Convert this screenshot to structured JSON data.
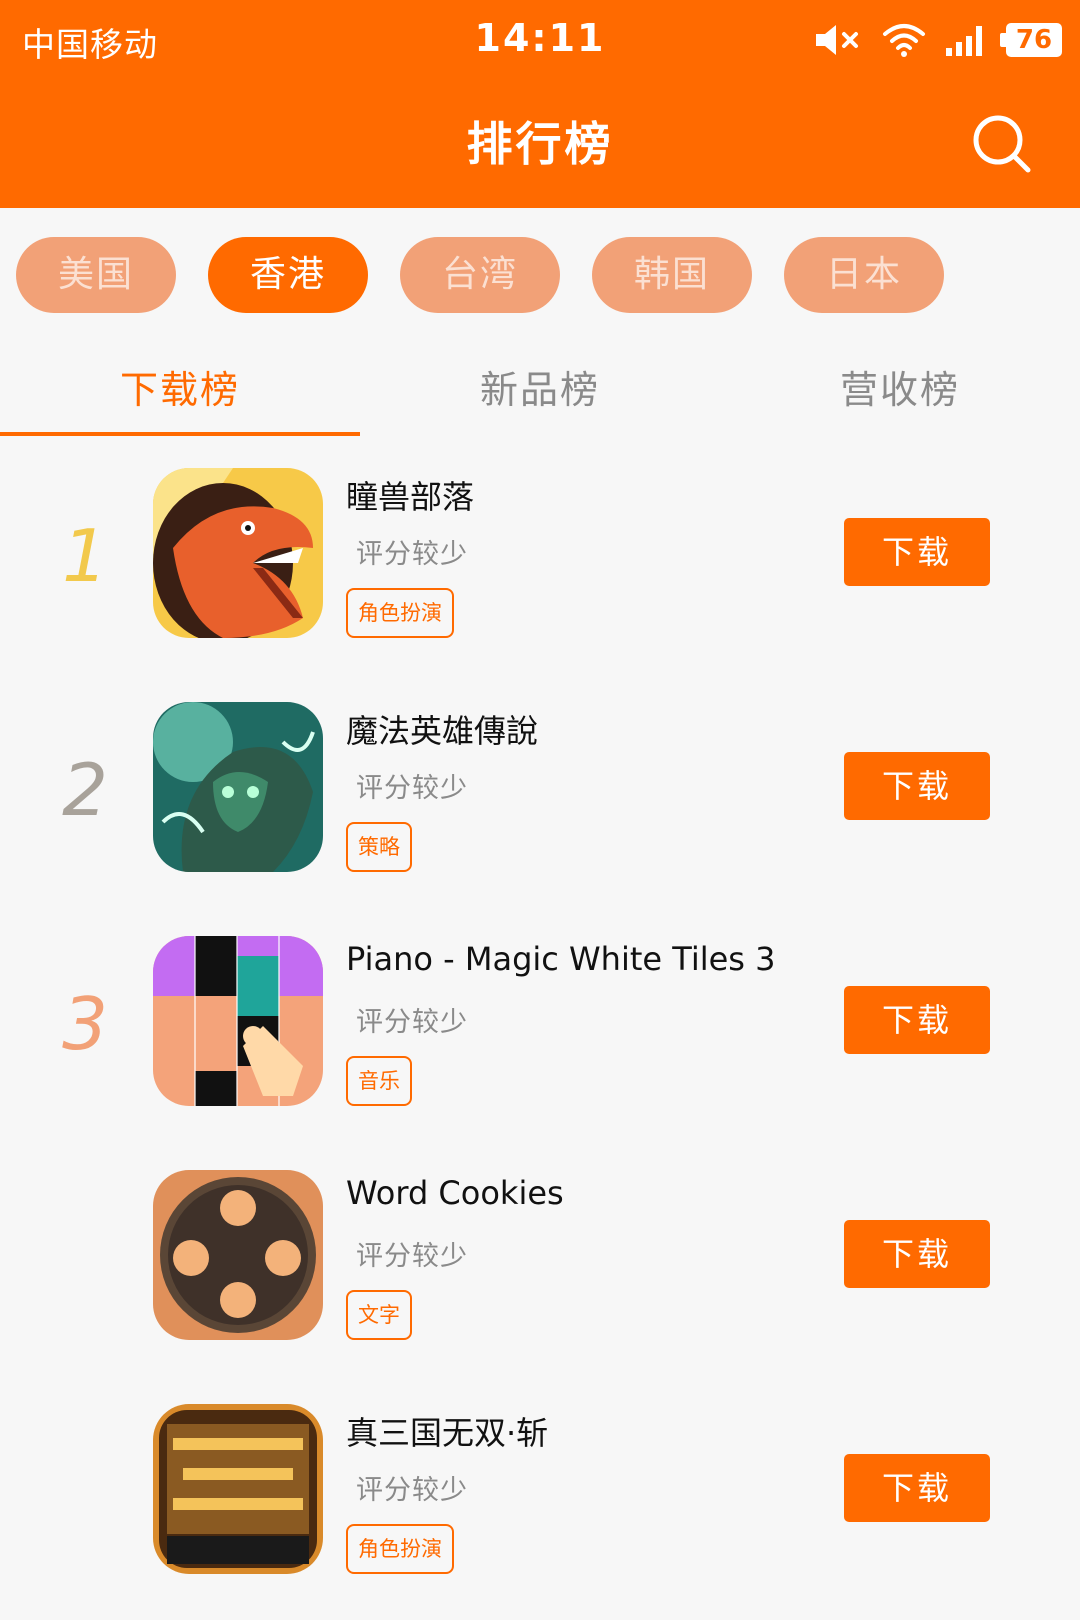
{
  "status_bar": {
    "carrier": "中国移动",
    "time": "14:11",
    "battery": "76",
    "icons": [
      "mute-icon",
      "wifi-icon",
      "signal-icon",
      "battery-icon"
    ]
  },
  "header": {
    "title": "排行榜",
    "search_icon": "search-icon",
    "background_color": "#ff6a00"
  },
  "regions": [
    {
      "label": "美国",
      "active": false
    },
    {
      "label": "香港",
      "active": true
    },
    {
      "label": "台湾",
      "active": false
    },
    {
      "label": "韩国",
      "active": false
    },
    {
      "label": "日本",
      "active": false
    }
  ],
  "tabs": [
    {
      "label": "下载榜",
      "active": true
    },
    {
      "label": "新品榜",
      "active": false
    },
    {
      "label": "营收榜",
      "active": false
    }
  ],
  "apps": [
    {
      "rank": "1",
      "name": "瞳兽部落",
      "rating": "评分较少",
      "tag": "角色扮演",
      "button": "下载",
      "rank_color": "#f2c94c"
    },
    {
      "rank": "2",
      "name": "魔法英雄傳說",
      "rating": "评分较少",
      "tag": "策略",
      "button": "下载",
      "rank_color": "#a8a29a"
    },
    {
      "rank": "3",
      "name": "Piano - Magic White Tiles 3",
      "rating": "评分较少",
      "tag": "音乐",
      "button": "下载",
      "rank_color": "#f2a177"
    },
    {
      "rank": "",
      "name": "Word Cookies",
      "rating": "评分较少",
      "tag": "文字",
      "button": "下载",
      "rank_color": "#a8a29a"
    },
    {
      "rank": "",
      "name": "真三国无双·斩",
      "rating": "评分较少",
      "tag": "角色扮演",
      "button": "下载",
      "rank_color": "#a8a29a"
    }
  ],
  "colors": {
    "accent": "#ff6a00",
    "chip_inactive": "#f2a177",
    "text_secondary": "#8a8a8a"
  }
}
